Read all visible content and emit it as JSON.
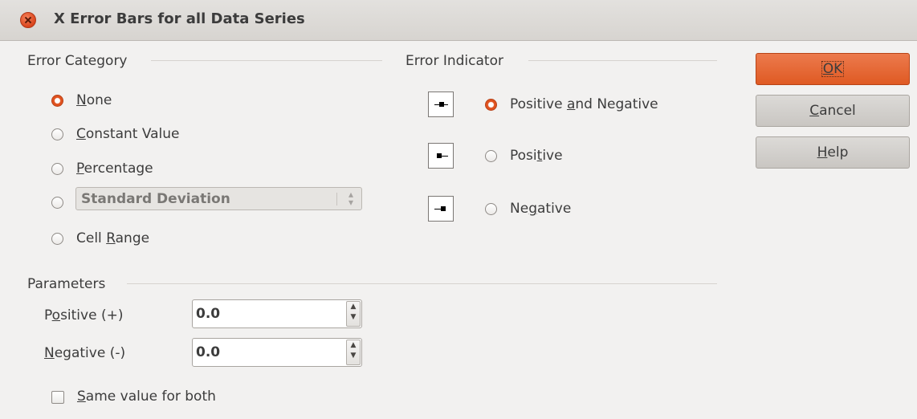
{
  "window": {
    "title": "X Error Bars for all Data Series"
  },
  "error_category": {
    "heading": "Error Category",
    "options": [
      {
        "pre": "",
        "mn": "N",
        "post": "one",
        "selected": true
      },
      {
        "pre": "",
        "mn": "C",
        "post": "onstant Value",
        "selected": false
      },
      {
        "pre": "",
        "mn": "P",
        "post": "ercentage",
        "selected": false
      },
      {
        "pre": "Cell ",
        "mn": "R",
        "post": "ange",
        "selected": false
      }
    ],
    "function_combo": {
      "value": "Standard Deviation",
      "selected": false
    }
  },
  "error_indicator": {
    "heading": "Error Indicator",
    "options": [
      {
        "pre": "Positive ",
        "mn": "a",
        "post": "nd Negative",
        "selected": true,
        "icon": "positive-and-negative-icon"
      },
      {
        "pre": "Posi",
        "mn": "t",
        "post": "ive",
        "selected": false,
        "icon": "positive-icon"
      },
      {
        "pre": "Ne",
        "mn": "g",
        "post": "ative",
        "selected": false,
        "icon": "negative-icon"
      }
    ]
  },
  "parameters": {
    "heading": "Parameters",
    "positive": {
      "pre": "P",
      "mn": "o",
      "post": "sitive (+)",
      "value": "0.0"
    },
    "negative": {
      "pre": "",
      "mn": "N",
      "post": "egative (-)",
      "value": "0.0"
    },
    "same_value": {
      "pre": "",
      "mn": "S",
      "post": "ame value for both",
      "checked": false
    }
  },
  "buttons": {
    "ok": {
      "pre": "",
      "mn": "O",
      "post": "K"
    },
    "cancel": {
      "pre": "",
      "mn": "C",
      "post": "ancel"
    },
    "help": {
      "pre": "",
      "mn": "H",
      "post": "elp"
    }
  },
  "colors": {
    "accent": "#df5a23",
    "background": "#f2f1f0",
    "titlebar": "#dad7d3"
  }
}
